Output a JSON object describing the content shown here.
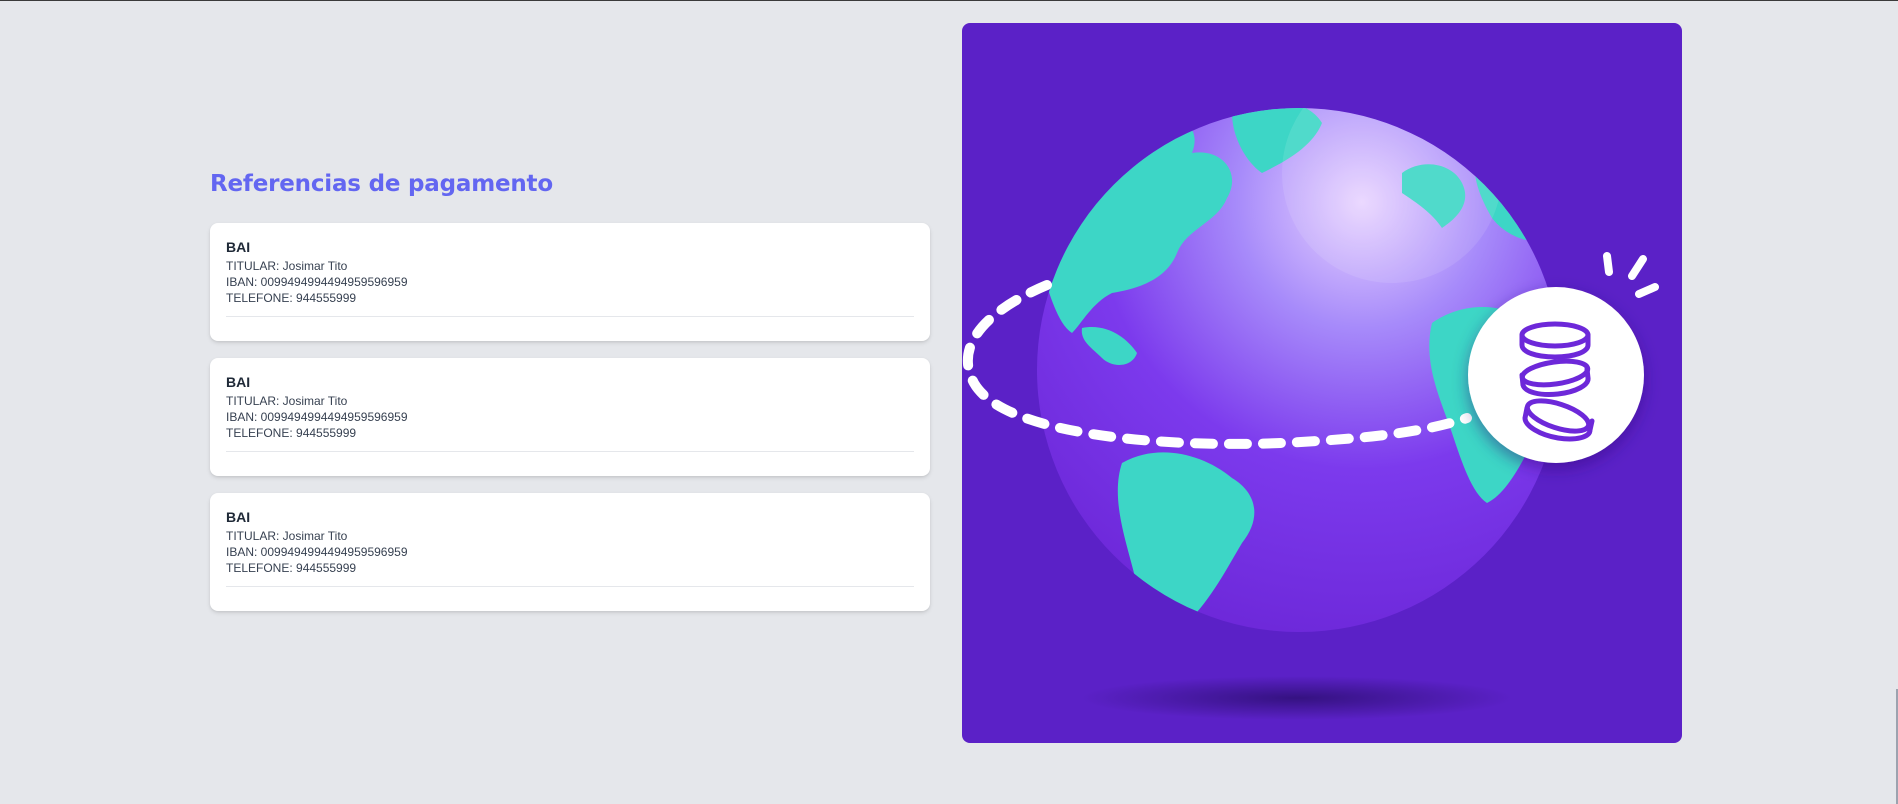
{
  "page": {
    "title": "Referencias de pagamento"
  },
  "payment_refs": [
    {
      "bank": "BAI",
      "titular": "TITULAR: Josimar Tito",
      "iban": "IBAN: 0099494994494959596959",
      "telefone": "TELEFONE: 944555999"
    },
    {
      "bank": "BAI",
      "titular": "TITULAR: Josimar Tito",
      "iban": "IBAN: 0099494994494959596959",
      "telefone": "TELEFONE: 944555999"
    },
    {
      "bank": "BAI",
      "titular": "TITULAR: Josimar Tito",
      "iban": "IBAN: 0099494994494959596959",
      "telefone": "TELEFONE: 944555999"
    }
  ],
  "illustration": {
    "icon": "globe-with-coins-icon",
    "colors": {
      "background": "#5b21c7",
      "ocean": "#7c3aed",
      "land": "#3dd6c6",
      "coin_badge": "#ffffff",
      "coin_stroke": "#6d28d9"
    }
  },
  "theme": {
    "accent": "#6366f1",
    "page_bg": "#e5e7eb",
    "card_bg": "#ffffff"
  }
}
